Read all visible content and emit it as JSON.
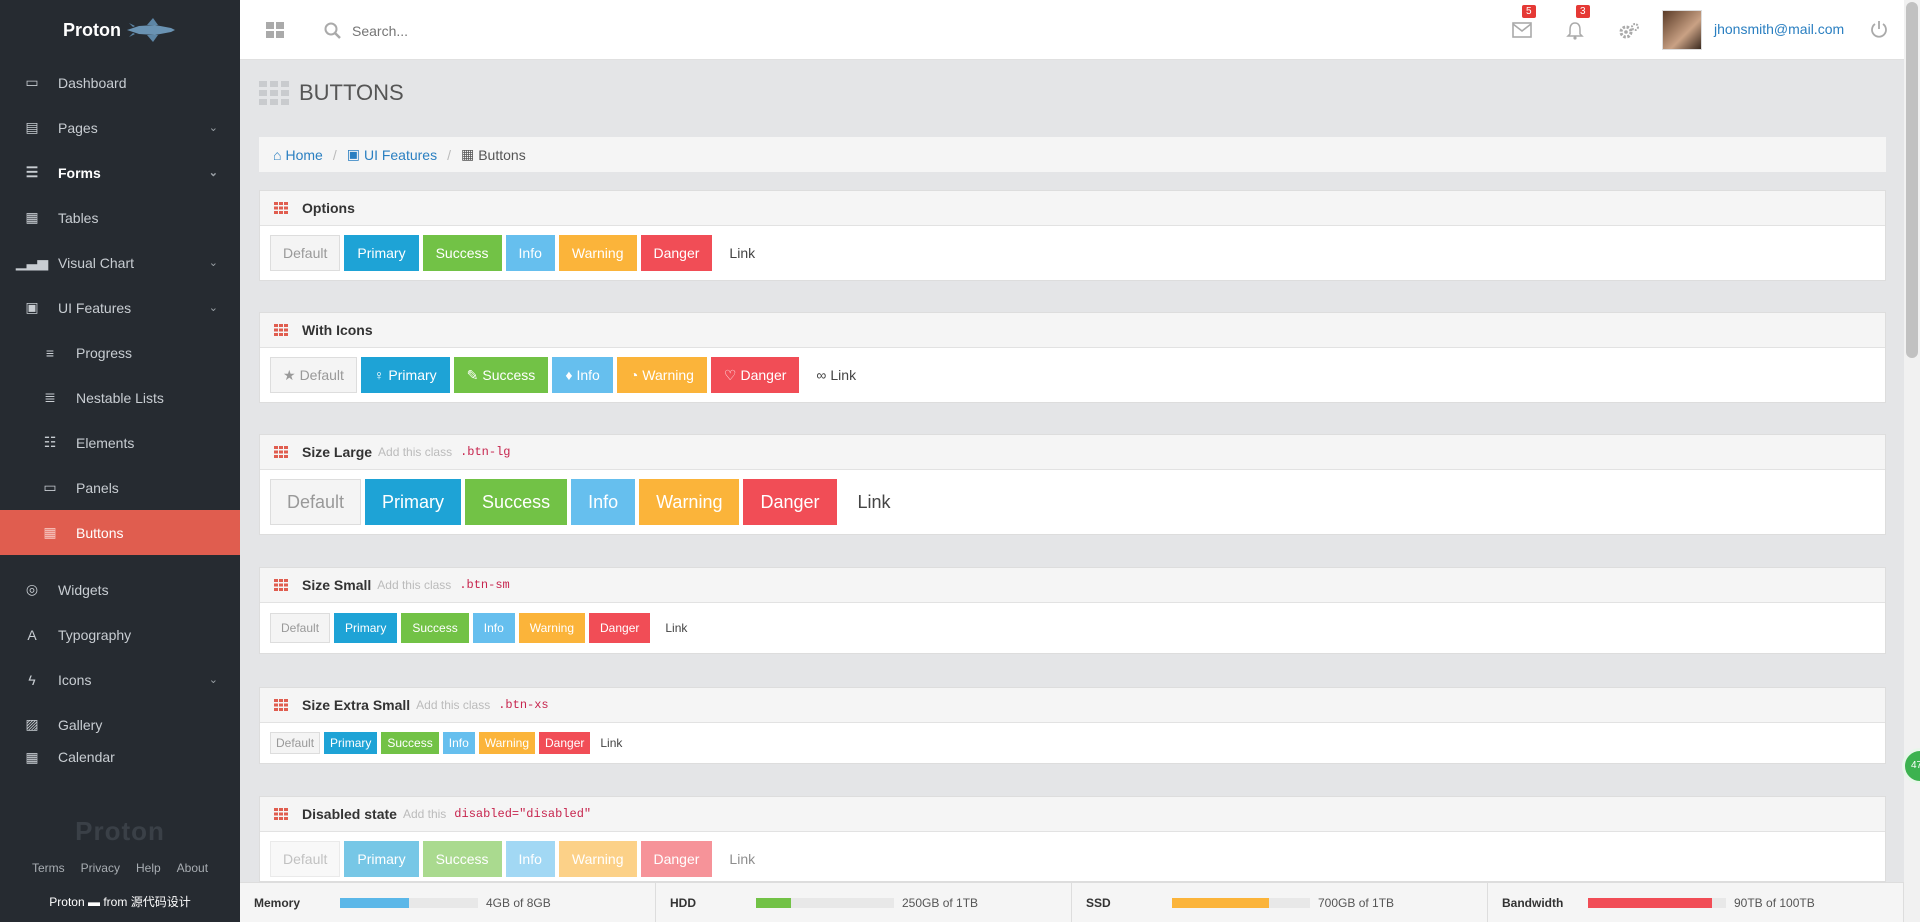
{
  "sidebar": {
    "brand": "Proton",
    "items": [
      {
        "label": "Dashboard",
        "name": "sidebar-item-dashboard",
        "icon": "laptop-icon",
        "glyph": "▭",
        "chevron": false
      },
      {
        "label": "Pages",
        "name": "sidebar-item-pages",
        "icon": "file-icon",
        "glyph": "▤",
        "chevron": true
      },
      {
        "label": "Forms",
        "name": "sidebar-item-forms",
        "icon": "list-alt-icon",
        "glyph": "☰",
        "chevron": true,
        "bold": true
      },
      {
        "label": "Tables",
        "name": "sidebar-item-tables",
        "icon": "table-icon",
        "glyph": "▦",
        "chevron": false
      },
      {
        "label": "Visual Chart",
        "name": "sidebar-item-visual-chart",
        "icon": "signal-icon",
        "glyph": "▁▃▅",
        "chevron": true
      },
      {
        "label": "UI Features",
        "name": "sidebar-item-ui-features",
        "icon": "briefcase-icon",
        "glyph": "▣",
        "chevron": true
      },
      {
        "label": "Progress",
        "name": "sidebar-item-progress",
        "icon": "align-left-icon",
        "glyph": "≡",
        "sub": true
      },
      {
        "label": "Nestable Lists",
        "name": "sidebar-item-nestable-lists",
        "icon": "indent-icon",
        "glyph": "≣",
        "sub": true
      },
      {
        "label": "Elements",
        "name": "sidebar-item-elements",
        "icon": "list-icon",
        "glyph": "☷",
        "sub": true
      },
      {
        "label": "Panels",
        "name": "sidebar-item-panels",
        "icon": "list-alt-icon",
        "glyph": "▭",
        "sub": true
      },
      {
        "label": "Buttons",
        "name": "sidebar-item-buttons",
        "icon": "th-icon",
        "glyph": "▦",
        "sub": true,
        "active": true
      },
      {
        "label": "Widgets",
        "name": "sidebar-item-widgets",
        "icon": "life-ring-icon",
        "glyph": "◎",
        "chevron": false
      },
      {
        "label": "Typography",
        "name": "sidebar-item-typography",
        "icon": "font-icon",
        "glyph": "A",
        "chevron": false
      },
      {
        "label": "Icons",
        "name": "sidebar-item-icons",
        "icon": "bolt-icon",
        "glyph": "ϟ",
        "chevron": true
      },
      {
        "label": "Gallery",
        "name": "sidebar-item-gallery",
        "icon": "picture-icon",
        "glyph": "▨",
        "chevron": false
      },
      {
        "label": "Calendar",
        "name": "sidebar-item-calendar",
        "icon": "calendar-icon",
        "glyph": "▦",
        "chevron": false
      }
    ],
    "footer_logo": "Proton",
    "footer_links": [
      "Terms",
      "Privacy",
      "Help",
      "About"
    ],
    "credit_brand": "Proton",
    "credit_from": "from",
    "credit_source": "源代码设计"
  },
  "header": {
    "search_placeholder": "Search...",
    "mail_count": "5",
    "notification_count": "3",
    "user_email": "jhonsmith@mail.com"
  },
  "page": {
    "title": "BUTTONS",
    "breadcrumb": {
      "home": "Home",
      "section": "UI Features",
      "current": "Buttons"
    }
  },
  "panels": [
    {
      "title": "Options",
      "hint": "",
      "code": "",
      "size": "md",
      "buttons": [
        {
          "label": "Default",
          "style": "default"
        },
        {
          "label": "Primary",
          "style": "primary"
        },
        {
          "label": "Success",
          "style": "success"
        },
        {
          "label": "Info",
          "style": "info"
        },
        {
          "label": "Warning",
          "style": "warning"
        },
        {
          "label": "Danger",
          "style": "danger"
        },
        {
          "label": "Link",
          "style": "link"
        }
      ]
    },
    {
      "title": "With Icons",
      "hint": "",
      "code": "",
      "size": "md",
      "buttons": [
        {
          "label": "Default",
          "style": "default",
          "icon": "star-icon",
          "glyph": "★"
        },
        {
          "label": "Primary",
          "style": "primary",
          "icon": "lightbulb-icon",
          "glyph": "♀"
        },
        {
          "label": "Success",
          "style": "success",
          "icon": "magic-icon",
          "glyph": "✎"
        },
        {
          "label": "Info",
          "style": "info",
          "icon": "map-marker-icon",
          "glyph": "♦"
        },
        {
          "label": "Warning",
          "style": "warning",
          "icon": "rss-icon",
          "glyph": "◔"
        },
        {
          "label": "Danger",
          "style": "danger",
          "icon": "heart-icon",
          "glyph": "♡"
        },
        {
          "label": "Link",
          "style": "link",
          "icon": "link-icon",
          "glyph": "∞"
        }
      ]
    },
    {
      "title": "Size Large",
      "hint": "Add this class",
      "code": ".btn-lg",
      "size": "lg",
      "buttons": [
        {
          "label": "Default",
          "style": "default"
        },
        {
          "label": "Primary",
          "style": "primary"
        },
        {
          "label": "Success",
          "style": "success"
        },
        {
          "label": "Info",
          "style": "info"
        },
        {
          "label": "Warning",
          "style": "warning"
        },
        {
          "label": "Danger",
          "style": "danger"
        },
        {
          "label": "Link",
          "style": "link"
        }
      ]
    },
    {
      "title": "Size Small",
      "hint": "Add this class",
      "code": ".btn-sm",
      "size": "sm",
      "buttons": [
        {
          "label": "Default",
          "style": "default"
        },
        {
          "label": "Primary",
          "style": "primary"
        },
        {
          "label": "Success",
          "style": "success"
        },
        {
          "label": "Info",
          "style": "info"
        },
        {
          "label": "Warning",
          "style": "warning"
        },
        {
          "label": "Danger",
          "style": "danger"
        },
        {
          "label": "Link",
          "style": "link"
        }
      ]
    },
    {
      "title": "Size Extra Small",
      "hint": "Add this class",
      "code": ".btn-xs",
      "size": "xs",
      "buttons": [
        {
          "label": "Default",
          "style": "default"
        },
        {
          "label": "Primary",
          "style": "primary"
        },
        {
          "label": "Success",
          "style": "success"
        },
        {
          "label": "Info",
          "style": "info"
        },
        {
          "label": "Warning",
          "style": "warning"
        },
        {
          "label": "Danger",
          "style": "danger"
        },
        {
          "label": "Link",
          "style": "link"
        }
      ]
    },
    {
      "title": "Disabled state",
      "hint": "Add this",
      "code": "disabled=\"disabled\"",
      "size": "disabled",
      "buttons": [
        {
          "label": "Default",
          "style": "default"
        },
        {
          "label": "Primary",
          "style": "primary"
        },
        {
          "label": "Success",
          "style": "success"
        },
        {
          "label": "Info",
          "style": "info"
        },
        {
          "label": "Warning",
          "style": "warning"
        },
        {
          "label": "Danger",
          "style": "danger"
        },
        {
          "label": "Link",
          "style": "link"
        }
      ]
    }
  ],
  "statusbar": [
    {
      "label": "Memory",
      "value": "4GB of 8GB",
      "fraction": 0.5,
      "color": "#5bb7e8"
    },
    {
      "label": "HDD",
      "value": "250GB of 1TB",
      "fraction": 0.25,
      "color": "#72c246"
    },
    {
      "label": "SSD",
      "value": "700GB of 1TB",
      "fraction": 0.7,
      "color": "#fbb43a"
    },
    {
      "label": "Bandwidth",
      "value": "90TB of 100TB",
      "fraction": 0.9,
      "color": "#f14d56"
    }
  ],
  "colors": {
    "sidebar_bg": "#262b31",
    "accent": "#e05d4f",
    "link": "#2a7fc1",
    "primary": "#1ea3d6",
    "success": "#72c246",
    "info": "#66bfee",
    "warning": "#fbb43a",
    "danger": "#f14d56"
  },
  "float_badge": "47"
}
